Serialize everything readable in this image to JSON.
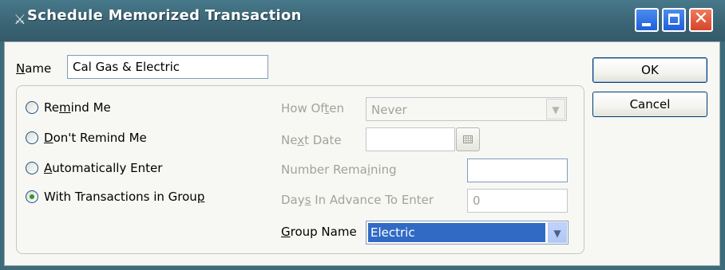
{
  "window": {
    "title": "Schedule Memorized Transaction",
    "icon": "pin-icon"
  },
  "name_field": {
    "label_pre": "",
    "label_access": "N",
    "label_post": "ame",
    "value": "Cal Gas & Electric"
  },
  "options": [
    {
      "pre": "Re",
      "access": "m",
      "post": "ind Me",
      "checked": false
    },
    {
      "pre": "",
      "access": "D",
      "post": "on't Remind Me",
      "checked": false
    },
    {
      "pre": "",
      "access": "A",
      "post": "utomatically Enter",
      "checked": false
    },
    {
      "pre": "With Transactions in Grou",
      "access": "p",
      "post": "",
      "checked": true
    }
  ],
  "how_often": {
    "pre": "How Of",
    "access": "t",
    "post": "en",
    "value": "Never"
  },
  "next_date": {
    "pre": "Ne",
    "access": "x",
    "post": "t Date",
    "value": ""
  },
  "number_remaining": {
    "pre": "Number Rema",
    "access": "i",
    "post": "ning",
    "value": ""
  },
  "days_in_advance": {
    "pre": "Day",
    "access": "s",
    "post": " In Advance To Enter",
    "value": "0"
  },
  "group_name": {
    "pre": "",
    "access": "G",
    "post": "roup Name",
    "value": "Electric"
  },
  "buttons": {
    "ok": "OK",
    "cancel": "Cancel"
  }
}
